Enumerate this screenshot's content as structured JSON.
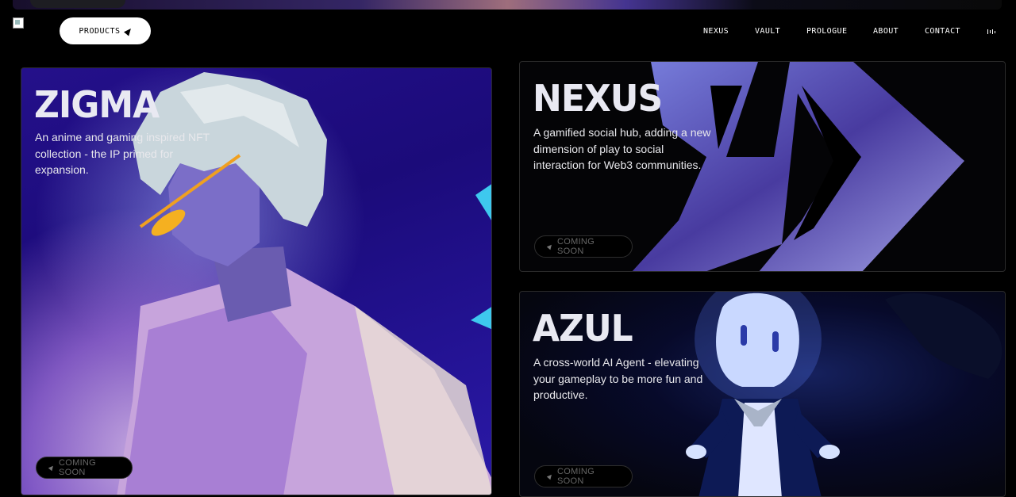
{
  "nav": {
    "products_label": "PRODUCTS",
    "items": [
      "NEXUS",
      "VAULT",
      "PROLOGUE",
      "ABOUT",
      "CONTACT"
    ]
  },
  "cards": [
    {
      "title": "ZIGMA",
      "description": "An anime and gaming inspired NFT collection - the IP primed for expansion.",
      "button": "COMING SOON"
    },
    {
      "title": "NEXUS",
      "description": "A gamified social hub, adding a new dimension of play to social interaction for Web3 communities.",
      "button": "COMING SOON"
    },
    {
      "title": "AZUL",
      "description": "A cross-world AI Agent - elevating your gameplay to be more fun and productive.",
      "button": "COMING SOON"
    }
  ],
  "colors": {
    "background": "#000000",
    "zigma_bg": "#24108a",
    "button_bg": "#ffffff"
  }
}
